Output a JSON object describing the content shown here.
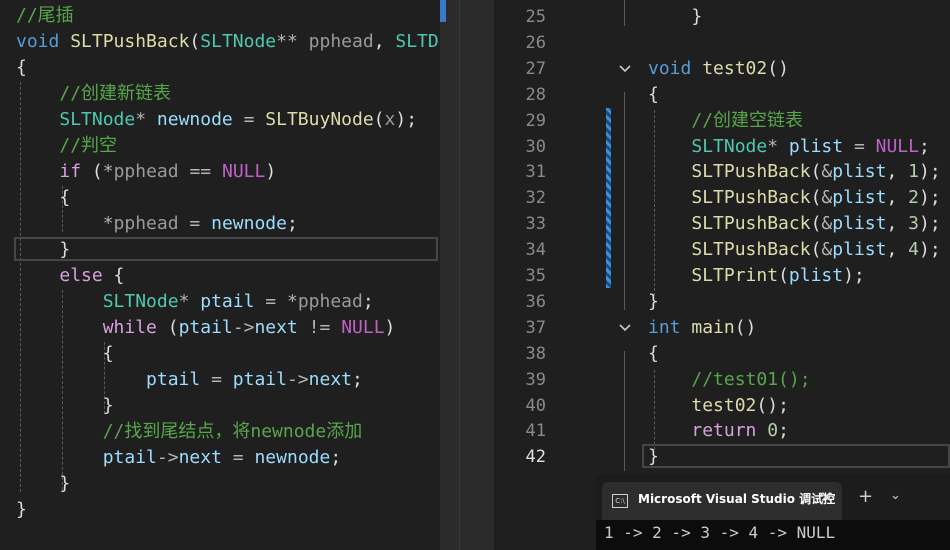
{
  "left_editor": {
    "lines": [
      [
        [
          "cm",
          "//尾插"
        ]
      ],
      [
        [
          "kw",
          "void"
        ],
        [
          "pl",
          " "
        ],
        [
          "fn",
          "SLTPushBack"
        ],
        [
          "pl",
          "("
        ],
        [
          "ty",
          "SLTNode"
        ],
        [
          "op",
          "**"
        ],
        [
          "pl",
          " "
        ],
        [
          "prm",
          "pphead"
        ],
        [
          "pl",
          ", "
        ],
        [
          "ty",
          "SLTDa"
        ]
      ],
      [
        [
          "pl",
          "{"
        ]
      ],
      [
        [
          "pl",
          "    "
        ],
        [
          "cm",
          "//创建新链表"
        ]
      ],
      [
        [
          "pl",
          "    "
        ],
        [
          "ty",
          "SLTNode"
        ],
        [
          "op",
          "*"
        ],
        [
          "pl",
          " "
        ],
        [
          "var",
          "newnode"
        ],
        [
          "pl",
          " "
        ],
        [
          "op",
          "="
        ],
        [
          "pl",
          " "
        ],
        [
          "fn",
          "SLTBuyNode"
        ],
        [
          "pl",
          "("
        ],
        [
          "prm",
          "x"
        ],
        [
          "pl",
          ");"
        ]
      ],
      [
        [
          "pl",
          "    "
        ],
        [
          "cm",
          "//判空"
        ]
      ],
      [
        [
          "pl",
          "    "
        ],
        [
          "ctl",
          "if"
        ],
        [
          "pl",
          " ("
        ],
        [
          "op",
          "*"
        ],
        [
          "prm",
          "pphead"
        ],
        [
          "pl",
          " "
        ],
        [
          "op",
          "=="
        ],
        [
          "pl",
          " "
        ],
        [
          "mac",
          "NULL"
        ],
        [
          "pl",
          ")"
        ]
      ],
      [
        [
          "pl",
          "    {"
        ]
      ],
      [
        [
          "pl",
          "        "
        ],
        [
          "op",
          "*"
        ],
        [
          "prm",
          "pphead"
        ],
        [
          "pl",
          " "
        ],
        [
          "op",
          "="
        ],
        [
          "pl",
          " "
        ],
        [
          "var",
          "newnode"
        ],
        [
          "pl",
          ";"
        ]
      ],
      [
        [
          "pl",
          "    }"
        ]
      ],
      [
        [
          "pl",
          "    "
        ],
        [
          "ctl",
          "else"
        ],
        [
          "pl",
          " {"
        ]
      ],
      [
        [
          "pl",
          "        "
        ],
        [
          "ty",
          "SLTNode"
        ],
        [
          "op",
          "*"
        ],
        [
          "pl",
          " "
        ],
        [
          "var",
          "ptail"
        ],
        [
          "pl",
          " "
        ],
        [
          "op",
          "="
        ],
        [
          "pl",
          " "
        ],
        [
          "op",
          "*"
        ],
        [
          "prm",
          "pphead"
        ],
        [
          "pl",
          ";"
        ]
      ],
      [
        [
          "pl",
          "        "
        ],
        [
          "ctl",
          "while"
        ],
        [
          "pl",
          " ("
        ],
        [
          "var",
          "ptail"
        ],
        [
          "op",
          "->"
        ],
        [
          "var",
          "next"
        ],
        [
          "pl",
          " "
        ],
        [
          "op",
          "!="
        ],
        [
          "pl",
          " "
        ],
        [
          "mac",
          "NULL"
        ],
        [
          "pl",
          ")"
        ]
      ],
      [
        [
          "pl",
          "        {"
        ]
      ],
      [
        [
          "pl",
          "            "
        ],
        [
          "var",
          "ptail"
        ],
        [
          "pl",
          " "
        ],
        [
          "op",
          "="
        ],
        [
          "pl",
          " "
        ],
        [
          "var",
          "ptail"
        ],
        [
          "op",
          "->"
        ],
        [
          "var",
          "next"
        ],
        [
          "pl",
          ";"
        ]
      ],
      [
        [
          "pl",
          "        }"
        ]
      ],
      [
        [
          "pl",
          "        "
        ],
        [
          "cm",
          "//找到尾结点，将newnode添加"
        ]
      ],
      [
        [
          "pl",
          "        "
        ],
        [
          "var",
          "ptail"
        ],
        [
          "op",
          "->"
        ],
        [
          "var",
          "next"
        ],
        [
          "pl",
          " "
        ],
        [
          "op",
          "="
        ],
        [
          "pl",
          " "
        ],
        [
          "var",
          "newnode"
        ],
        [
          "pl",
          ";"
        ]
      ],
      [
        [
          "pl",
          "    }"
        ]
      ],
      [
        [
          "pl",
          "}"
        ]
      ]
    ]
  },
  "right_editor": {
    "line_numbers": [
      "25",
      "26",
      "27",
      "28",
      "29",
      "30",
      "31",
      "32",
      "33",
      "34",
      "35",
      "36",
      "37",
      "38",
      "39",
      "40",
      "41",
      "42"
    ],
    "current_line": "42",
    "lines": [
      [
        [
          "pl",
          "    }"
        ]
      ],
      [],
      [
        [
          "kw",
          "void"
        ],
        [
          "pl",
          " "
        ],
        [
          "fn",
          "test02"
        ],
        [
          "pl",
          "()"
        ]
      ],
      [
        [
          "pl",
          "{"
        ]
      ],
      [
        [
          "pl",
          "    "
        ],
        [
          "cm",
          "//创建空链表"
        ]
      ],
      [
        [
          "pl",
          "    "
        ],
        [
          "ty",
          "SLTNode"
        ],
        [
          "op",
          "*"
        ],
        [
          "pl",
          " "
        ],
        [
          "var",
          "plist"
        ],
        [
          "pl",
          " "
        ],
        [
          "op",
          "="
        ],
        [
          "pl",
          " "
        ],
        [
          "mac",
          "NULL"
        ],
        [
          "pl",
          ";"
        ]
      ],
      [
        [
          "pl",
          "    "
        ],
        [
          "fn",
          "SLTPushBack"
        ],
        [
          "pl",
          "("
        ],
        [
          "op",
          "&"
        ],
        [
          "var",
          "plist"
        ],
        [
          "pl",
          ", "
        ],
        [
          "num",
          "1"
        ],
        [
          "pl",
          ");"
        ]
      ],
      [
        [
          "pl",
          "    "
        ],
        [
          "fn",
          "SLTPushBack"
        ],
        [
          "pl",
          "("
        ],
        [
          "op",
          "&"
        ],
        [
          "var",
          "plist"
        ],
        [
          "pl",
          ", "
        ],
        [
          "num",
          "2"
        ],
        [
          "pl",
          ");"
        ]
      ],
      [
        [
          "pl",
          "    "
        ],
        [
          "fn",
          "SLTPushBack"
        ],
        [
          "pl",
          "("
        ],
        [
          "op",
          "&"
        ],
        [
          "var",
          "plist"
        ],
        [
          "pl",
          ", "
        ],
        [
          "num",
          "3"
        ],
        [
          "pl",
          ");"
        ]
      ],
      [
        [
          "pl",
          "    "
        ],
        [
          "fn",
          "SLTPushBack"
        ],
        [
          "pl",
          "("
        ],
        [
          "op",
          "&"
        ],
        [
          "var",
          "plist"
        ],
        [
          "pl",
          ", "
        ],
        [
          "num",
          "4"
        ],
        [
          "pl",
          ");"
        ]
      ],
      [
        [
          "pl",
          "    "
        ],
        [
          "fn",
          "SLTPrint"
        ],
        [
          "pl",
          "("
        ],
        [
          "var",
          "plist"
        ],
        [
          "pl",
          ");"
        ]
      ],
      [
        [
          "pl",
          "}"
        ]
      ],
      [
        [
          "kw",
          "int"
        ],
        [
          "pl",
          " "
        ],
        [
          "fn",
          "main"
        ],
        [
          "pl",
          "()"
        ]
      ],
      [
        [
          "pl",
          "{"
        ]
      ],
      [
        [
          "pl",
          "    "
        ],
        [
          "cm",
          "//test01();"
        ]
      ],
      [
        [
          "pl",
          "    "
        ],
        [
          "fn",
          "test02"
        ],
        [
          "pl",
          "();"
        ]
      ],
      [
        [
          "pl",
          "    "
        ],
        [
          "ctl",
          "return"
        ],
        [
          "pl",
          " "
        ],
        [
          "num",
          "0"
        ],
        [
          "pl",
          ";"
        ]
      ],
      [
        [
          "pl",
          "}"
        ]
      ]
    ]
  },
  "colors": {
    "comment": "#57a64a",
    "keyword": "#569cd6",
    "control": "#d8a0df",
    "type": "#4ec9b0",
    "function": "#dcdcaa",
    "variable": "#9cdcfe",
    "parameter": "#9a9a9a",
    "macro": "#bd63c5",
    "number": "#b5cea8",
    "background": "#1f1f1f",
    "change_marker": "#3d8fe0"
  },
  "terminal": {
    "tab_icon": "console-icon",
    "tab_icon_text": "C:\\",
    "tab_title": "Microsoft Visual Studio 调试控",
    "close_glyph": "✕",
    "new_tab_glyph": "+",
    "menu_glyph": "⌄",
    "output": "1 -> 2 -> 3 -> 4 -> NULL"
  }
}
